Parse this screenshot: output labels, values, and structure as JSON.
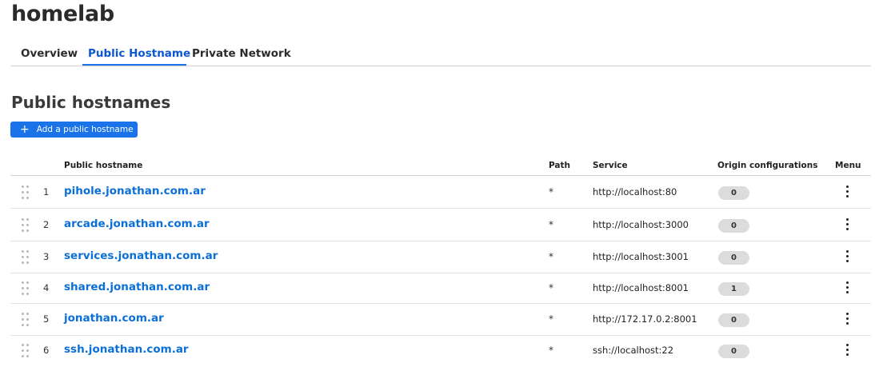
{
  "app": {
    "title": "homelab"
  },
  "tabs": [
    {
      "label": "Overview",
      "active": false
    },
    {
      "label": "Public Hostname",
      "active": true
    },
    {
      "label": "Private Network",
      "active": false
    }
  ],
  "section": {
    "title": "Public hostnames",
    "add_button_label": "Add a public hostname"
  },
  "table": {
    "headers": {
      "hostname": "Public hostname",
      "path": "Path",
      "service": "Service",
      "origin": "Origin configurations",
      "menu": "Menu"
    },
    "rows": [
      {
        "index": "1",
        "hostname": "pihole.jonathan.com.ar",
        "path": "*",
        "service": "http://localhost:80",
        "origin_count": "0"
      },
      {
        "index": "2",
        "hostname": "arcade.jonathan.com.ar",
        "path": "*",
        "service": "http://localhost:3000",
        "origin_count": "0"
      },
      {
        "index": "3",
        "hostname": "services.jonathan.com.ar",
        "path": "*",
        "service": "http://localhost:3001",
        "origin_count": "0"
      },
      {
        "index": "4",
        "hostname": "shared.jonathan.com.ar",
        "path": "*",
        "service": "http://localhost:8001",
        "origin_count": "1"
      },
      {
        "index": "5",
        "hostname": "jonathan.com.ar",
        "path": "*",
        "service": "http://172.17.0.2:8001",
        "origin_count": "0"
      },
      {
        "index": "6",
        "hostname": "ssh.jonathan.com.ar",
        "path": "*",
        "service": "ssh://localhost:22",
        "origin_count": "0"
      }
    ]
  },
  "colors": {
    "accent": "#1a73e8",
    "link": "#0b6fd8",
    "badge_bg": "#dcdcdc"
  },
  "icons": {
    "add": "plus-icon",
    "drag": "drag-handle-icon",
    "menu": "vertical-ellipsis-icon"
  }
}
